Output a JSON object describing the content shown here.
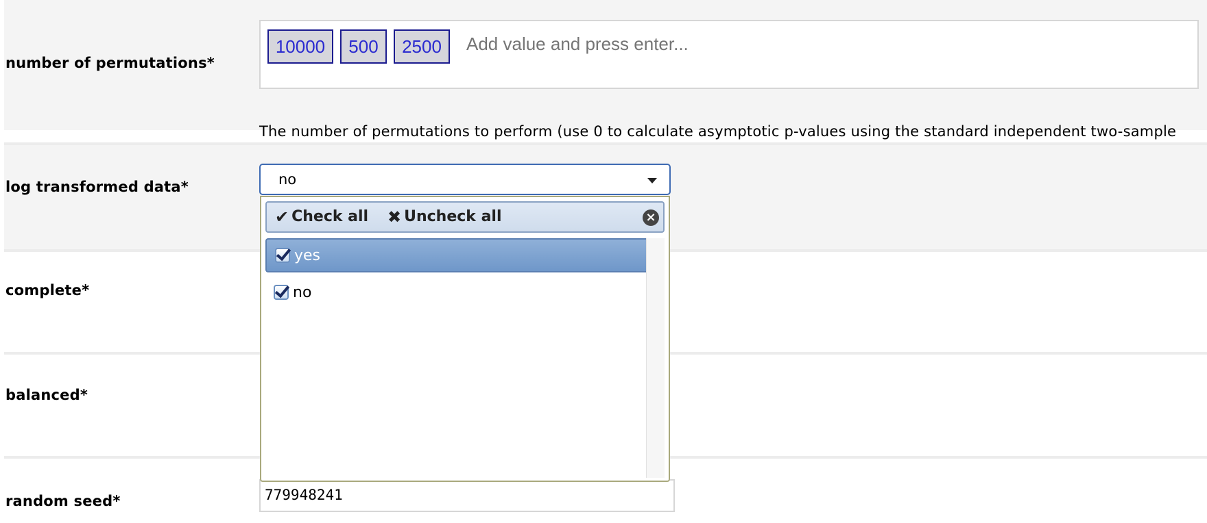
{
  "fields": {
    "permutations": {
      "label": "number of permutations*",
      "tags": [
        "10000",
        "500",
        "2500"
      ],
      "placeholder": "Add value and press enter...",
      "help": "The number of permutations to perform (use 0 to calculate asymptotic p-values using the standard independent two-sample"
    },
    "log_transformed": {
      "label": "log transformed data*",
      "selected": "no"
    },
    "complete": {
      "label": "complete*"
    },
    "balanced": {
      "label": "balanced*"
    },
    "random_seed": {
      "label": "random seed*",
      "value": "779948241"
    }
  },
  "dropdown": {
    "check_all": "Check all",
    "uncheck_all": "Uncheck all",
    "options": [
      {
        "label": "yes",
        "checked": true,
        "highlighted": true
      },
      {
        "label": "no",
        "checked": true,
        "highlighted": false
      }
    ]
  },
  "icons": {
    "check_all": "checkmark-icon",
    "uncheck_all": "x-icon",
    "close": "close-circle-icon",
    "dropdown_arrow": "caret-down-icon"
  },
  "colors": {
    "tag_border": "#1b1b8f",
    "tag_text": "#2b2bd0",
    "select_border": "#3e6bb3",
    "highlight": "#7a9fd0"
  }
}
